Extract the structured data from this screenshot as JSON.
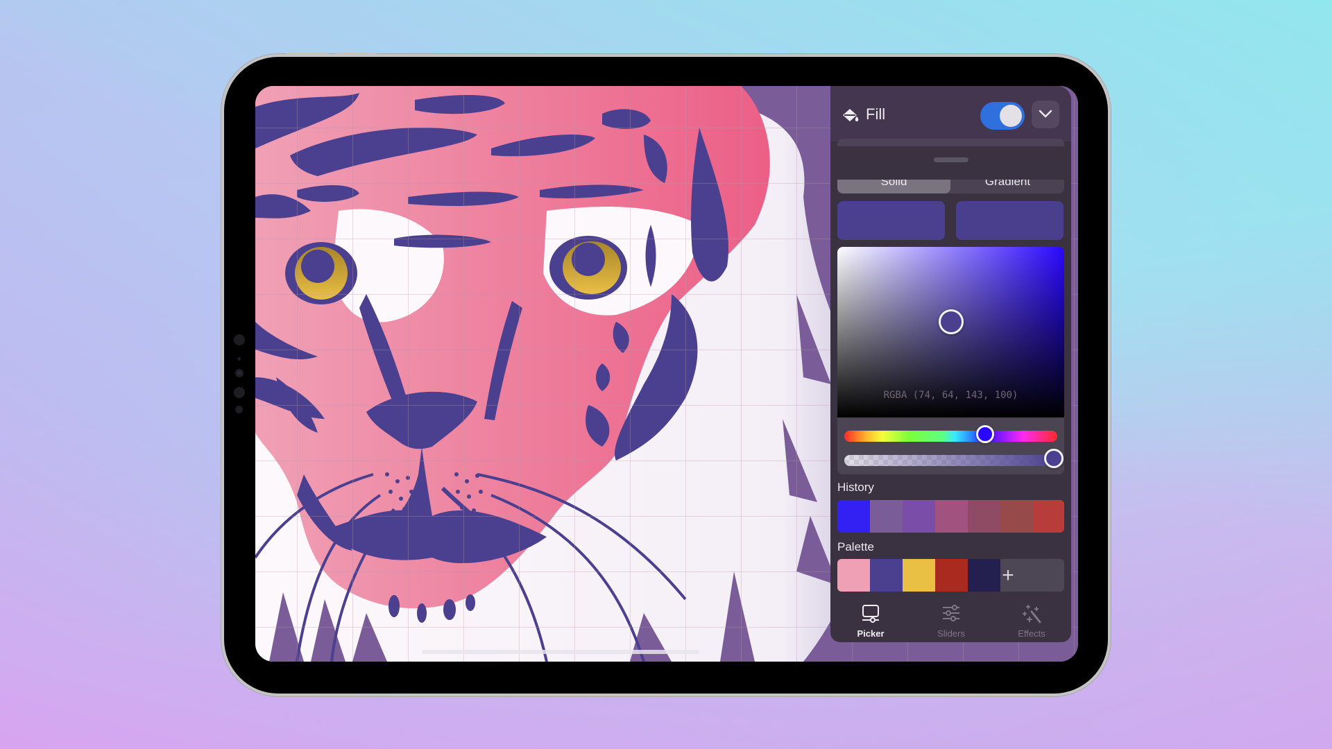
{
  "app": {
    "panel_title": "Fill",
    "fill_enabled": true,
    "fill_type_tabs": [
      "Solid",
      "Gradient"
    ],
    "selected_fill_type": "Solid",
    "current_color": {
      "rgba_label": "RGBA (74, 64, 143, 100)",
      "r": 74,
      "g": 64,
      "b": 143,
      "a": 100,
      "hex": "#4a408f"
    },
    "previous_color_hex": "#4a3f8c",
    "hue_slider_fraction": 0.66,
    "alpha_slider_fraction": 1.0,
    "saturation_fraction": 0.5,
    "brightness_fraction": 0.56,
    "history_label": "History",
    "history_colors": [
      "#3320f2",
      "#7a5c98",
      "#7a4ea8",
      "#a1527e",
      "#8f4a64",
      "#974a4a",
      "#b83c3a"
    ],
    "palette_label": "Palette",
    "palette_colors": [
      "#f0a0b5",
      "#4a408f",
      "#e9bf44",
      "#ab2a20",
      "#23204f"
    ],
    "palette_add_label": "+",
    "bottom_tabs": [
      {
        "label": "Picker",
        "icon": "picker-icon",
        "active": true
      },
      {
        "label": "Sliders",
        "icon": "sliders-icon",
        "active": false
      },
      {
        "label": "Effects",
        "icon": "magic-wand-icon",
        "active": false
      }
    ]
  },
  "canvas": {
    "artwork": "tiger-face-illustration",
    "colors": {
      "background": "#7a5c98",
      "stripes": "#4a408f",
      "fur_pink": "#f0a0b5",
      "fur_white": "#fdf8fb",
      "eye_gold": "#e9bf44",
      "grid": "rgba(190,160,175,0.45)"
    }
  }
}
